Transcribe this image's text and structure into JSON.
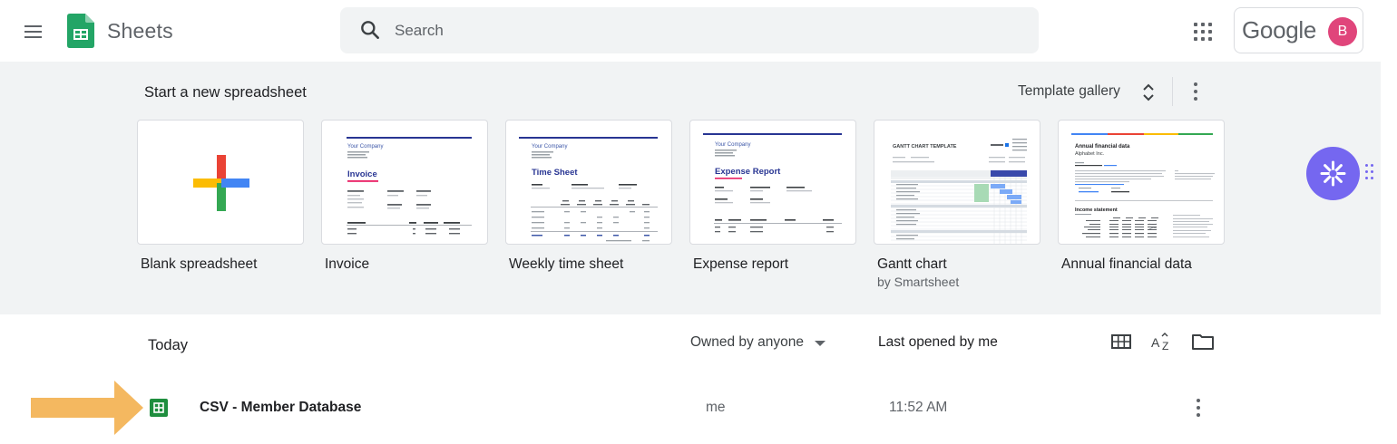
{
  "header": {
    "app_title": "Sheets",
    "search_placeholder": "Search",
    "google_wordmark": "Google",
    "avatar_initial": "B"
  },
  "templates": {
    "section_title": "Start a new spreadsheet",
    "gallery_label": "Template gallery",
    "items": [
      {
        "name": "Blank spreadsheet",
        "subtitle": ""
      },
      {
        "name": "Invoice",
        "subtitle": "",
        "preview": {
          "company": "Your Company",
          "heading": "Invoice"
        }
      },
      {
        "name": "Weekly time sheet",
        "subtitle": "",
        "preview": {
          "company": "Your Company",
          "heading": "Time Sheet"
        }
      },
      {
        "name": "Expense report",
        "subtitle": "",
        "preview": {
          "company": "Your Company",
          "heading": "Expense Report"
        }
      },
      {
        "name": "Gantt chart",
        "subtitle": "by Smartsheet",
        "preview": {
          "heading": "GANTT CHART TEMPLATE"
        }
      },
      {
        "name": "Annual financial data",
        "subtitle": "",
        "preview": {
          "heading": "Annual financial data",
          "company": "Alphabet Inc.",
          "section": "Income statement"
        }
      }
    ]
  },
  "files": {
    "section_title": "Today",
    "owner_filter": "Owned by anyone",
    "sort_label": "Last opened by me",
    "rows": [
      {
        "name": "CSV - Member Database",
        "owner": "me",
        "time": "11:52 AM"
      }
    ]
  },
  "colors": {
    "accent_green": "#1e8e3e",
    "band_background": "#f1f3f4",
    "avatar": "#e0457b",
    "fab": "#7567f0",
    "arrow": "#f4b860",
    "template_blue": "#3c57a8"
  }
}
